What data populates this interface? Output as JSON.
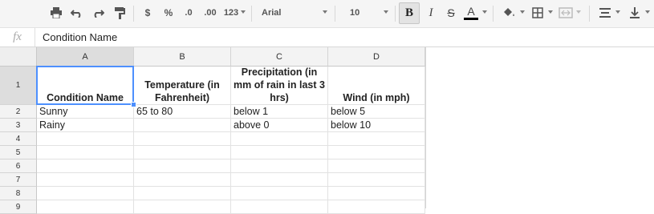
{
  "toolbar": {
    "currency": "$",
    "percent": "%",
    "decrease_decimal": ".0",
    "increase_decimal": ".00",
    "more_formats": "123",
    "font_family": "Arial",
    "font_size": "10",
    "bold": "B",
    "italic": "I",
    "strikethrough": "S",
    "text_color_label": "A"
  },
  "formula_bar": {
    "fx_label": "fx",
    "value": "Condition Name"
  },
  "columns": [
    "A",
    "B",
    "C",
    "D"
  ],
  "rows": [
    {
      "num": "1",
      "cells": [
        "Condition Name",
        "Temperature (in Fahrenheit)",
        "Precipitation (in mm of rain in last 3 hrs)",
        "Wind (in mph)"
      ]
    },
    {
      "num": "2",
      "cells": [
        "Sunny",
        "65 to 80",
        "below 1",
        "below 5"
      ]
    },
    {
      "num": "3",
      "cells": [
        "Rainy",
        "",
        "above 0",
        "below 10"
      ]
    },
    {
      "num": "4",
      "cells": [
        "",
        "",
        "",
        ""
      ]
    },
    {
      "num": "5",
      "cells": [
        "",
        "",
        "",
        ""
      ]
    },
    {
      "num": "6",
      "cells": [
        "",
        "",
        "",
        ""
      ]
    },
    {
      "num": "7",
      "cells": [
        "",
        "",
        "",
        ""
      ]
    },
    {
      "num": "8",
      "cells": [
        "",
        "",
        "",
        ""
      ]
    },
    {
      "num": "9",
      "cells": [
        "",
        "",
        "",
        ""
      ]
    }
  ],
  "selected_cell": "A1",
  "colors": {
    "selection": "#4d90fe",
    "toolbar_bg": "#f5f5f5",
    "header_bg": "#f3f3f3"
  },
  "icons": [
    "print-icon",
    "undo-icon",
    "redo-icon",
    "paint-format-icon",
    "fill-color-icon",
    "borders-icon",
    "merge-cells-icon",
    "align-horizontal-icon",
    "align-vertical-icon"
  ]
}
